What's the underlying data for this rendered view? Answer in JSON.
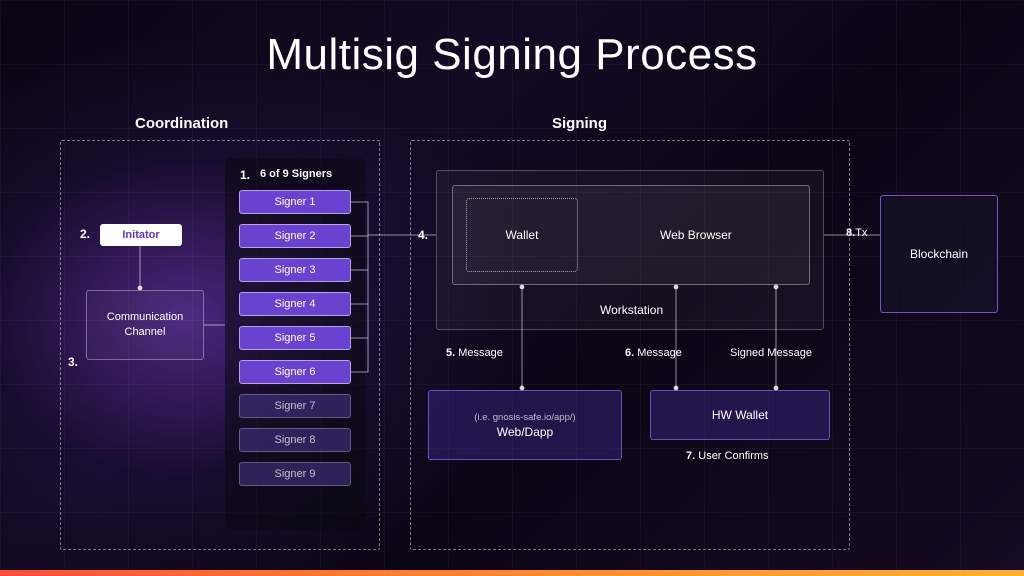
{
  "title": "Multisig Signing Process",
  "sections": {
    "coordination": "Coordination",
    "signing": "Signing"
  },
  "initiator": "Initator",
  "comm_channel": "Communication Channel",
  "signer_header": "6 of 9 Signers",
  "signers": [
    "Signer 1",
    "Signer 2",
    "Signer 3",
    "Signer 4",
    "Signer 5",
    "Signer 6",
    "Signer 7",
    "Signer 8",
    "Signer 9"
  ],
  "workstation": {
    "wallet": "Wallet",
    "browser": "Web Browser",
    "label": "Workstation"
  },
  "webdapp": {
    "sub": "(i.e. gnosis-safe.io/app/)",
    "label": "Web/Dapp"
  },
  "hwwallet": "HW Wallet",
  "blockchain": "Blockchain",
  "steps": {
    "s1": "1.",
    "s2": "2.",
    "s3": "3.",
    "s4": "4.",
    "s5": {
      "n": "5.",
      "t": "Message"
    },
    "s6": {
      "n": "6.",
      "t": "Message"
    },
    "s6b": "Signed Message",
    "s7": {
      "n": "7.",
      "t": "User Confirms"
    },
    "s8": {
      "n": "8.",
      "t": "Tx"
    }
  }
}
